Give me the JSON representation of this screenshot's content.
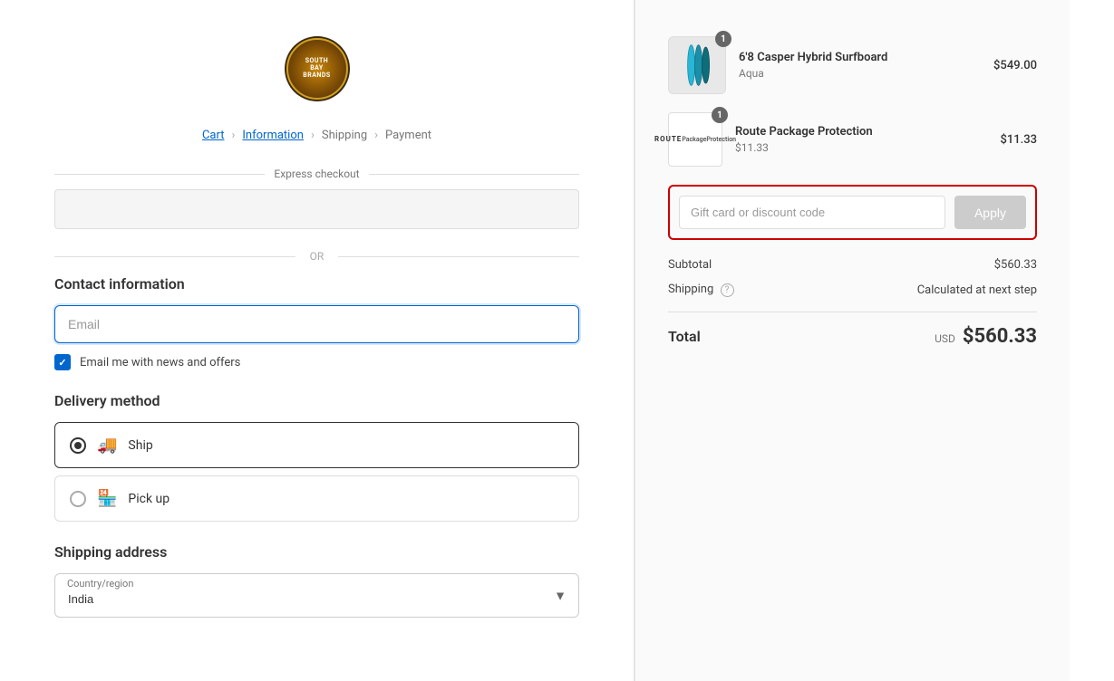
{
  "logo": {
    "brand_name": "South Bay Brands",
    "line1": "South",
    "line2": "Bay",
    "line3": "Brands"
  },
  "breadcrumb": {
    "items": [
      {
        "label": "Cart",
        "active": true
      },
      {
        "label": "Information",
        "active": true
      },
      {
        "label": "Shipping",
        "active": false
      },
      {
        "label": "Payment",
        "active": false
      }
    ]
  },
  "express_checkout": {
    "label": "Express checkout"
  },
  "or_divider": "OR",
  "contact": {
    "section_title": "Contact information",
    "email_placeholder": "Email",
    "newsletter_label": "Email me with news and offers"
  },
  "delivery": {
    "section_title": "Delivery method",
    "options": [
      {
        "value": "ship",
        "label": "Ship",
        "selected": true
      },
      {
        "value": "pickup",
        "label": "Pick up",
        "selected": false
      }
    ]
  },
  "shipping_address": {
    "section_title": "Shipping address",
    "country_label": "Country/region",
    "country_value": "India"
  },
  "right_panel": {
    "items": [
      {
        "id": "surfboard",
        "name": "6'8 Casper Hybrid Surfboard",
        "variant": "Aqua",
        "price": "$549.00",
        "quantity": 1,
        "type": "surfboard"
      },
      {
        "id": "route",
        "name": "Route Package Protection",
        "variant": "$11.33",
        "price": "$11.33",
        "quantity": 1,
        "type": "route"
      }
    ],
    "discount_placeholder": "Gift card or discount code",
    "apply_label": "Apply",
    "subtotal_label": "Subtotal",
    "subtotal_value": "$560.33",
    "shipping_label": "Shipping",
    "shipping_value": "Calculated at next step",
    "total_label": "Total",
    "total_currency": "USD",
    "total_amount": "$560.33"
  }
}
